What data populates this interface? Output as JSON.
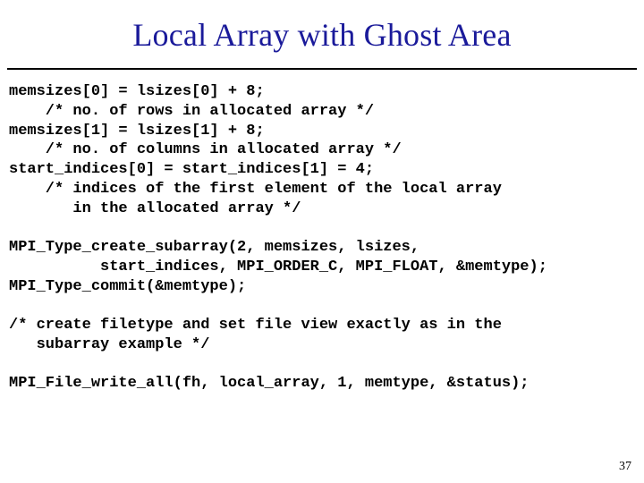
{
  "title": "Local Array with Ghost Area",
  "code": "memsizes[0] = lsizes[0] + 8;\n    /* no. of rows in allocated array */\nmemsizes[1] = lsizes[1] + 8;\n    /* no. of columns in allocated array */\nstart_indices[0] = start_indices[1] = 4;\n    /* indices of the first element of the local array\n       in the allocated array */\n\nMPI_Type_create_subarray(2, memsizes, lsizes,\n          start_indices, MPI_ORDER_C, MPI_FLOAT, &memtype);\nMPI_Type_commit(&memtype);\n\n/* create filetype and set file view exactly as in the\n   subarray example */\n\nMPI_File_write_all(fh, local_array, 1, memtype, &status);",
  "page_number": "37"
}
